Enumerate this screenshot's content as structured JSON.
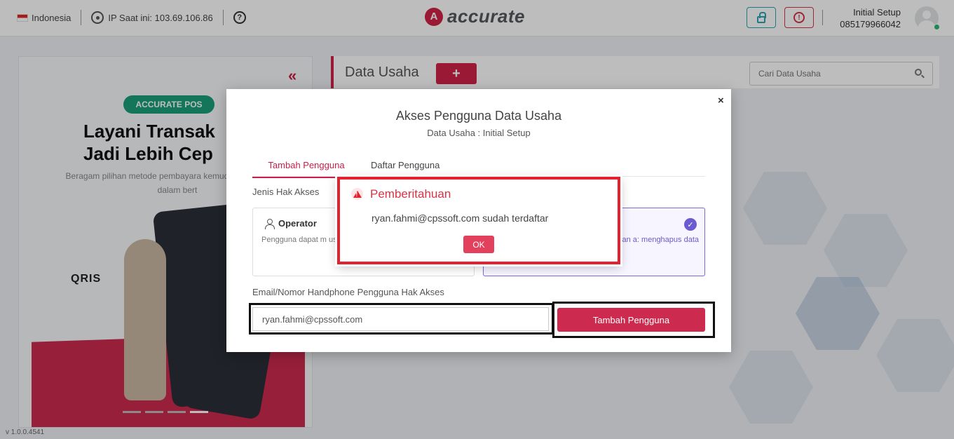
{
  "topbar": {
    "country": "Indonesia",
    "ip_text": "IP Saat ini: 103.69.106.86",
    "help_symbol": "?",
    "logo_mark": "A",
    "logo_text": "accurate",
    "user_name": "Initial Setup",
    "user_phone": "085179966042",
    "icons": [
      "flag-icon",
      "location-pin-icon",
      "help-icon",
      "lock-icon",
      "alert-icon",
      "avatar-icon"
    ]
  },
  "promo": {
    "collapse_symbol": "«",
    "badge": "ACCURATE POS",
    "headline": "Layani Transak\nJadi Lebih Cep",
    "subtext": "Beragam pilihan metode pembayara kemudahan pelanggan dalam bert",
    "qris": "QRIS"
  },
  "version": "v 1.0.0.4541",
  "data_usaha": {
    "title": "Data Usaha",
    "add_symbol": "+",
    "search_placeholder": "Cari Data Usaha"
  },
  "modal": {
    "close_symbol": "×",
    "title": "Akses Pengguna Data Usaha",
    "subtitle": "Data Usaha : Initial Setup",
    "tabs": [
      {
        "label": "Tambah Pengguna",
        "active": true
      },
      {
        "label": "Daftar Pengguna",
        "active": false
      }
    ],
    "section_label": "Jenis Hak Akses",
    "roles": {
      "operator": {
        "name": "Operator",
        "description": "Pengguna dapat m usaha. Penentuan h setelah login ke dat"
      },
      "admin": {
        "check_symbol": "✓",
        "description": "uka dan a: menghapus data"
      }
    },
    "email_label": "Email/Nomor Handphone Pengguna Hak Akses",
    "email_value": "ryan.fahmi@cpssoft.com",
    "add_button": "Tambah Pengguna"
  },
  "notification": {
    "title": "Pemberitahuan",
    "message": "ryan.fahmi@cpssoft.com sudah terdaftar",
    "ok_label": "OK"
  },
  "colors": {
    "brand": "#d0244a",
    "teal": "#2aa5b5",
    "alert_red": "#e5202f",
    "admin_purple": "#6b5bd0"
  }
}
